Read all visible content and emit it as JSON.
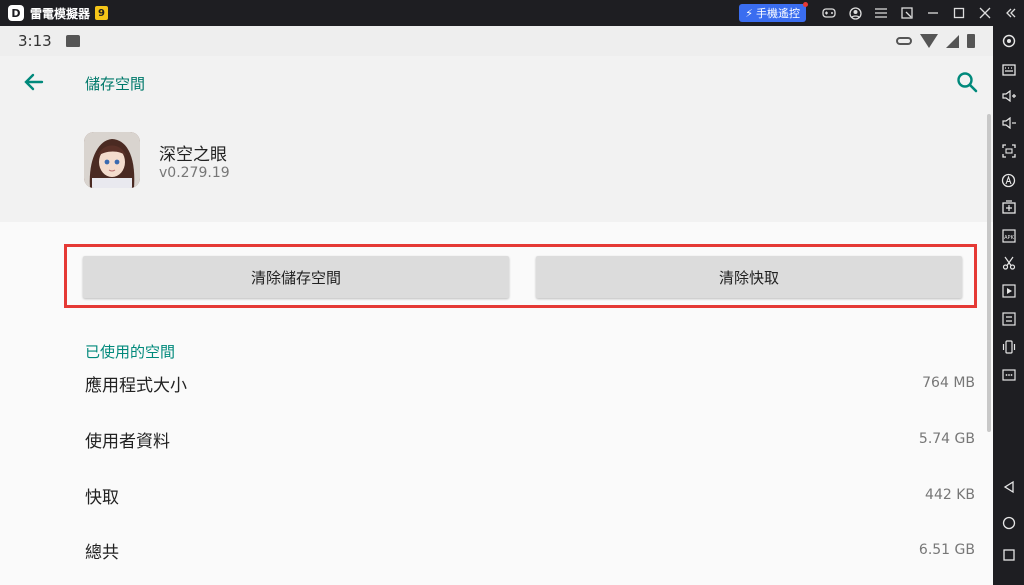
{
  "emulator": {
    "title": "雷電模擬器",
    "version_badge": "9",
    "gamepad_label": "手機遙控",
    "colors": {
      "chrome": "#1e1e22",
      "accent": "#3a6df0",
      "highlight": "#e53935"
    }
  },
  "statusbar": {
    "time": "3:13"
  },
  "appbar": {
    "title": "儲存空間"
  },
  "app": {
    "name": "深空之眼",
    "version": "v0.279.19"
  },
  "actions": {
    "clear_storage": "清除儲存空間",
    "clear_cache": "清除快取"
  },
  "usage": {
    "section_title": "已使用的空間",
    "rows": [
      {
        "label": "應用程式大小",
        "value": "764 MB"
      },
      {
        "label": "使用者資料",
        "value": "5.74 GB"
      },
      {
        "label": "快取",
        "value": "442 KB"
      },
      {
        "label": "總共",
        "value": "6.51 GB"
      }
    ]
  },
  "theme": {
    "teal": "#00897b",
    "background": "#fafafa"
  }
}
